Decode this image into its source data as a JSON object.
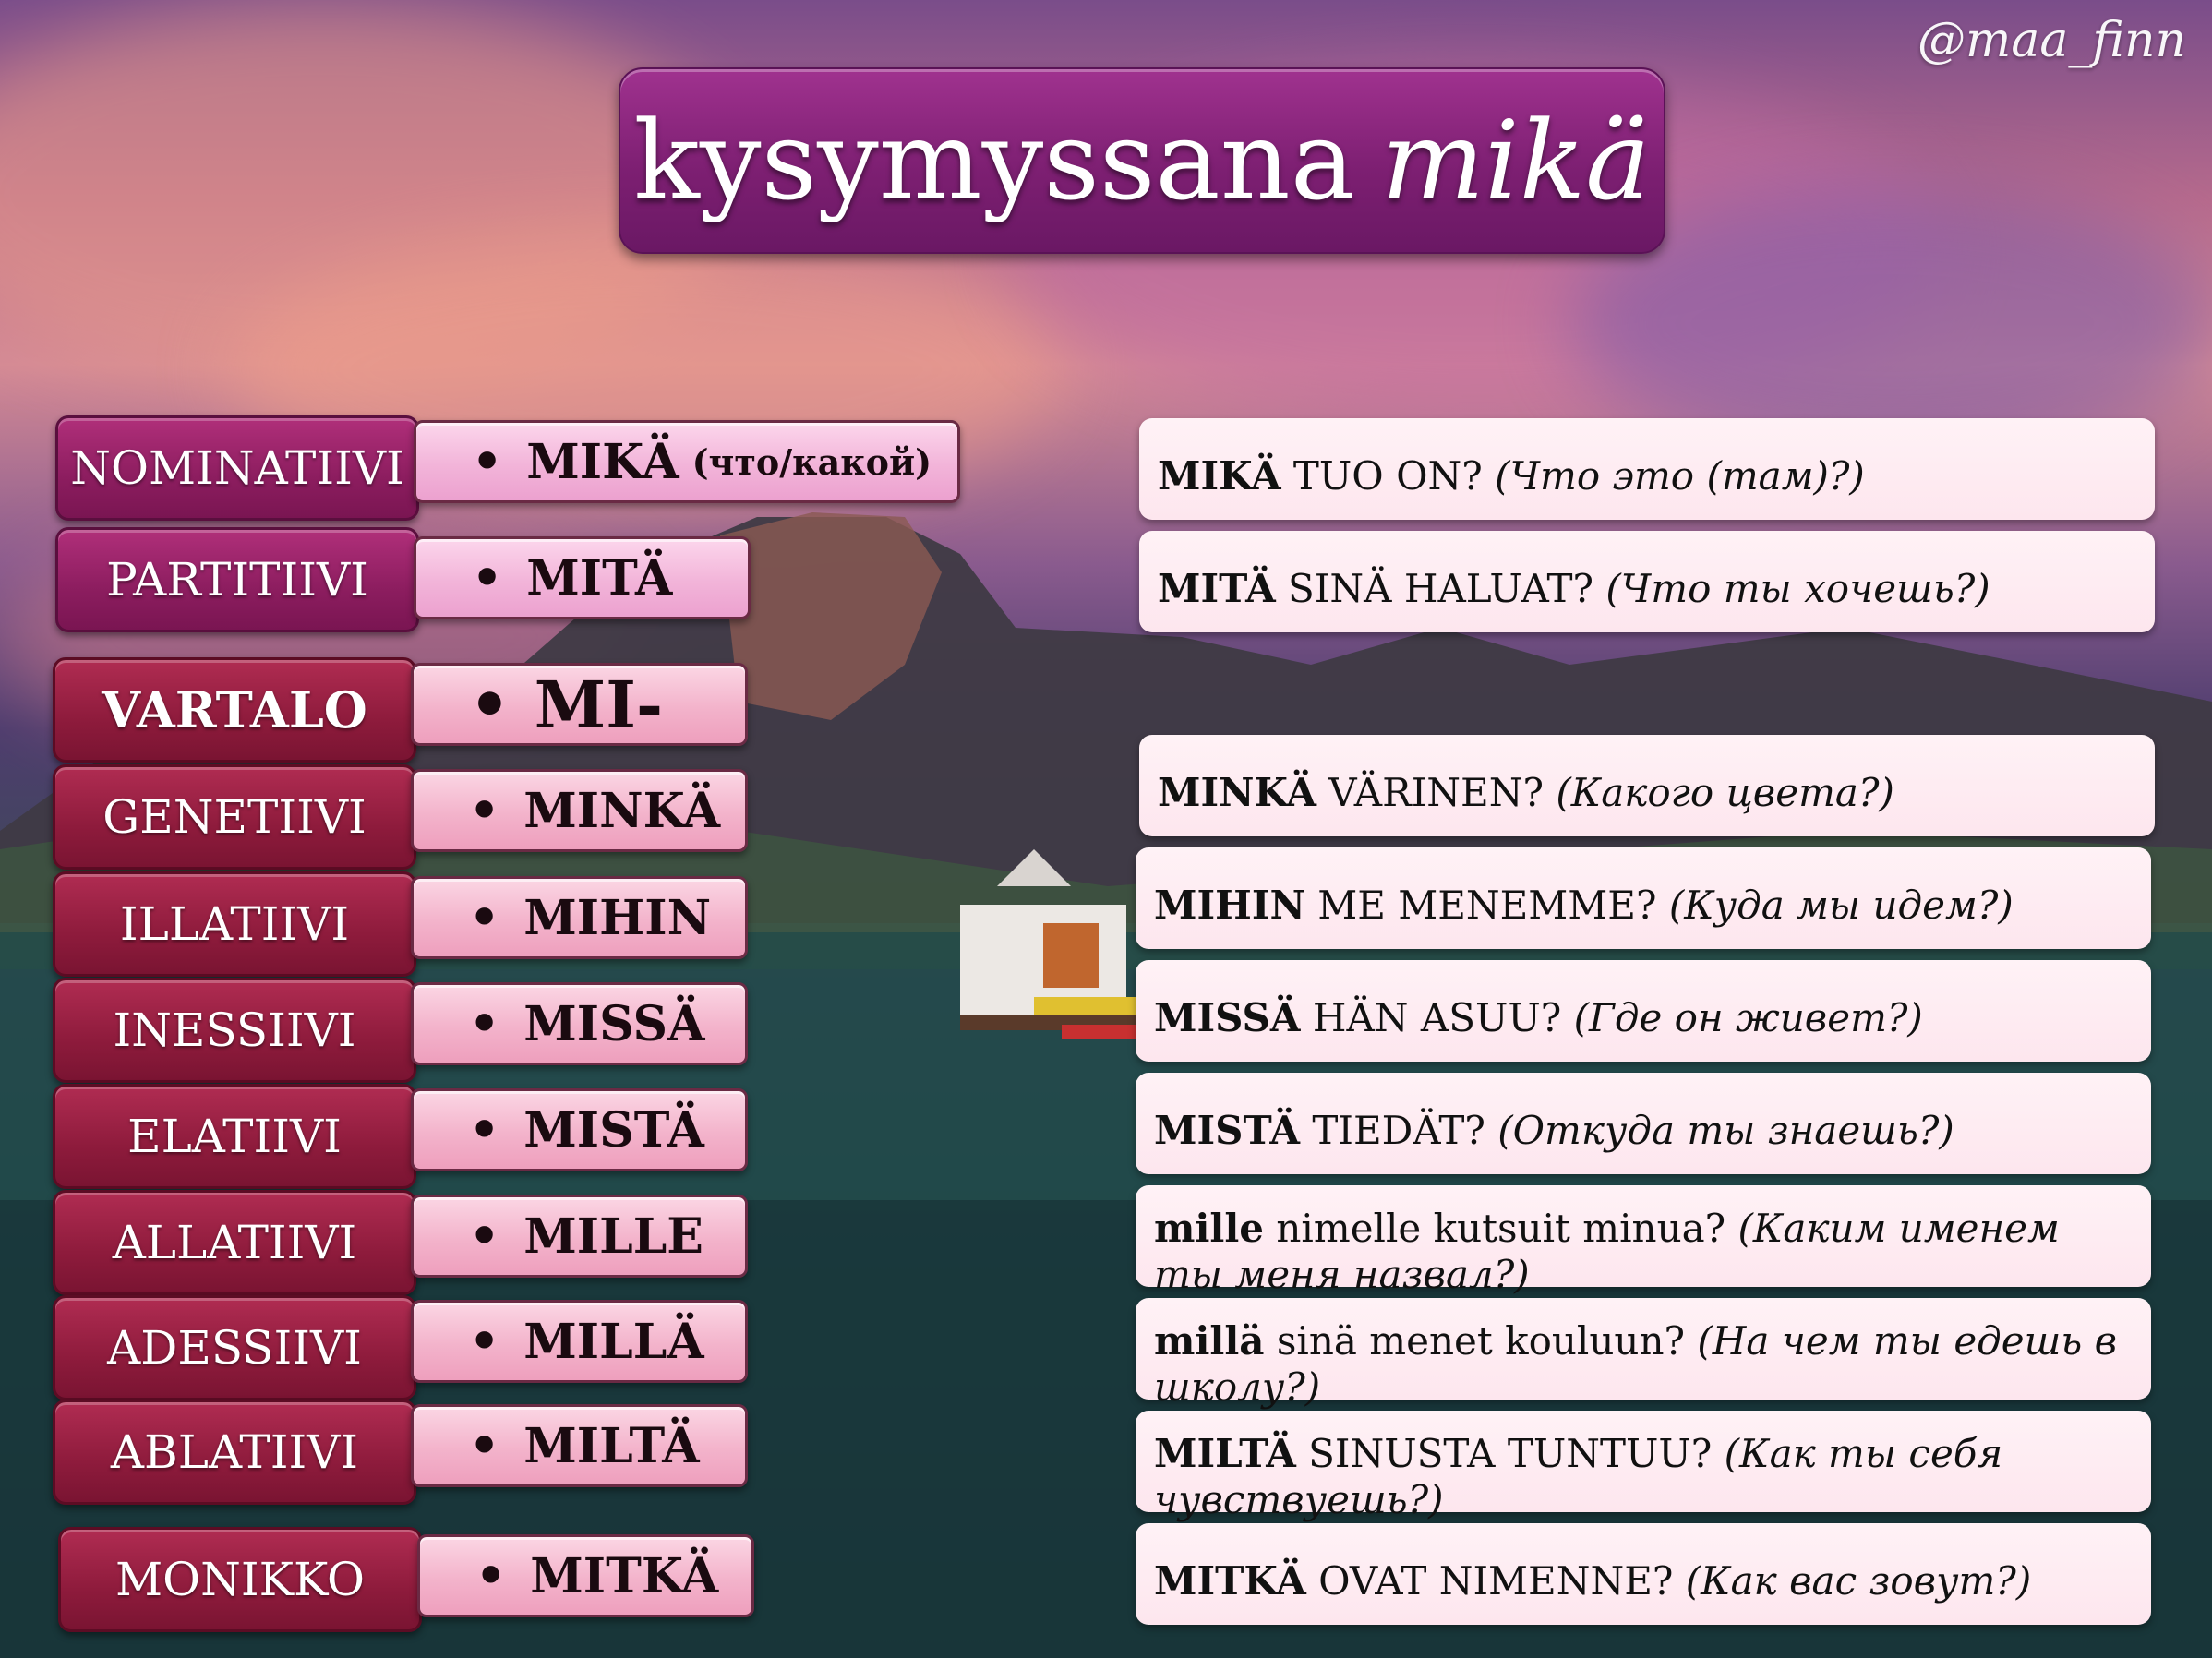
{
  "watermark": "@maa_finn",
  "title": {
    "main": "kysymyssana",
    "italic": "mikä"
  },
  "rows": [
    {
      "case": "NOMINATIIVI",
      "form": "MIKÄ",
      "note": "(что/какой)"
    },
    {
      "case": "PARTITIIVI",
      "form": "MITÄ"
    },
    {
      "case": "VARTALO",
      "form": "MI-"
    },
    {
      "case": "GENETIIVI",
      "form": "MINKÄ"
    },
    {
      "case": "ILLATIIVI",
      "form": "MIHIN"
    },
    {
      "case": "INESSIIVI",
      "form": "MISSÄ"
    },
    {
      "case": "ELATIIVI",
      "form": "MISTÄ"
    },
    {
      "case": "ALLATIIVI",
      "form": "MILLE"
    },
    {
      "case": "ADESSIIVI",
      "form": "MILLÄ"
    },
    {
      "case": "ABLATIIVI",
      "form": "MILTÄ"
    },
    {
      "case": "MONIKKO",
      "form": "MITKÄ"
    }
  ],
  "bullet": "•",
  "examples": [
    {
      "q": "MIKÄ",
      "rest": " TUO ON? ",
      "tr": "(Что это (там)?)"
    },
    {
      "q": "MITÄ",
      "rest": " SINÄ HALUAT? ",
      "tr": "(Что ты хочешь?)"
    },
    {
      "q": "MINKÄ",
      "rest": " VÄRINEN? ",
      "tr": "(Какого цвета?)"
    },
    {
      "q": "MIHIN",
      "rest": " ME MENEMME? ",
      "tr": "(Куда мы идем?)"
    },
    {
      "q": "MISSÄ",
      "rest": " HÄN ASUU? ",
      "tr": "(Где он живет?)"
    },
    {
      "q": "MISTÄ",
      "rest": " TIEDÄT? ",
      "tr": "(Откуда ты знаешь?)"
    },
    {
      "q": "mille",
      "rest": " nimelle kutsuit minua? ",
      "tr": "(Каким именем ты меня назвал?)"
    },
    {
      "q": "millä",
      "rest": " sinä menet kouluun? ",
      "tr": "(На чем ты едешь в школу?)"
    },
    {
      "q": "MILTÄ",
      "rest": " SINUSTA TUNTUU? ",
      "tr": "(Как ты себя чувствуешь?)"
    },
    {
      "q": "MITKÄ",
      "rest": " OVAT NIMENNE? ",
      "tr": "(Как вас зовут?)"
    }
  ]
}
